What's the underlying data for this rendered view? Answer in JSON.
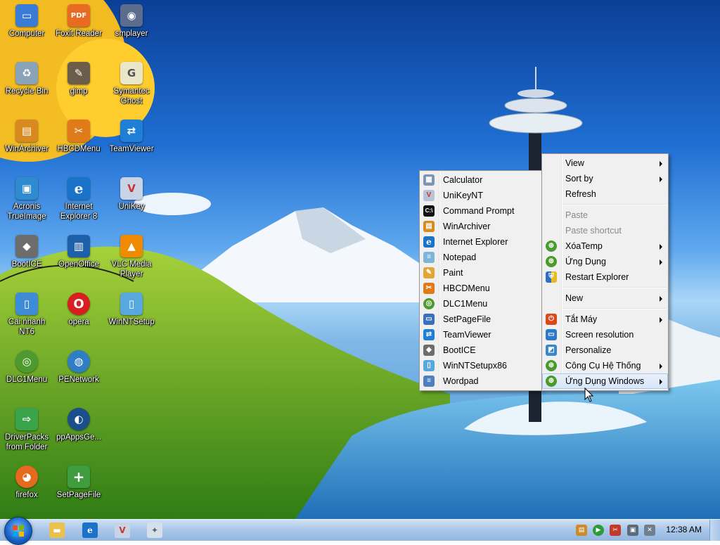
{
  "desktop_icons": [
    {
      "label": "Computer",
      "icon": "computer-icon",
      "color": "#3a7bd5",
      "glyph": "▭"
    },
    {
      "label": "Foxit Reader",
      "icon": "pdf-icon",
      "color": "#e96b22",
      "glyph": "PDF"
    },
    {
      "label": "smplayer",
      "icon": "smplayer-icon",
      "color": "#5b6c8c",
      "glyph": "◉"
    },
    {
      "label": "Recycle Bin",
      "icon": "recycle-bin-icon",
      "color": "#8ba3b9",
      "glyph": "♻"
    },
    {
      "label": "gimp",
      "icon": "gimp-icon",
      "color": "#6b5d4a",
      "glyph": "✎"
    },
    {
      "label": "Symantec Ghost",
      "icon": "ghost-icon",
      "color": "#e9e7c8",
      "glyph": "👻"
    },
    {
      "label": "WinArchiver",
      "icon": "archive-icon",
      "color": "#d98a1e",
      "glyph": "▤"
    },
    {
      "label": "HBCDMenu",
      "icon": "tools-icon",
      "color": "#e07b1a",
      "glyph": "✂"
    },
    {
      "label": "TeamViewer",
      "icon": "teamviewer-icon",
      "color": "#1f7fd6",
      "glyph": "⇄"
    },
    {
      "label": "Acronis TrueImage",
      "icon": "acronis-icon",
      "color": "#2e8bd0",
      "glyph": "▣"
    },
    {
      "label": "Internet Explorer 8",
      "icon": "ie-icon",
      "color": "#1a73c9",
      "glyph": "e"
    },
    {
      "label": "UniKey",
      "icon": "unikey-icon",
      "color": "#c8d4e6",
      "glyph": "V"
    },
    {
      "label": "BootICE",
      "icon": "bootice-icon",
      "color": "#6d6d6d",
      "glyph": "◆"
    },
    {
      "label": "OpenOffice",
      "icon": "openoffice-icon",
      "color": "#1d5fa8",
      "glyph": "▥"
    },
    {
      "label": "VLC Media Player",
      "icon": "vlc-icon",
      "color": "#f08a00",
      "glyph": "▲"
    },
    {
      "label": "Cai nhanh NT6",
      "icon": "setup-icon",
      "color": "#3e8bd6",
      "glyph": "▯"
    },
    {
      "label": "opera",
      "icon": "opera-icon",
      "color": "#d81e1e",
      "glyph": "O"
    },
    {
      "label": "WinNTSetup",
      "icon": "winntsetup-icon",
      "color": "#58a8e0",
      "glyph": "▯"
    },
    {
      "label": "DLC1Menu",
      "icon": "dlc-icon",
      "color": "#4f9a2e",
      "glyph": "◎"
    },
    {
      "label": "PENetwork",
      "icon": "network-icon",
      "color": "#2d7ec4",
      "glyph": "◍"
    },
    {
      "label": "DriverPacks from Folder",
      "icon": "driverpacks-icon",
      "color": "#3aa44a",
      "glyph": "⇨"
    },
    {
      "label": "ppAppsGe...",
      "icon": "ppapps-icon",
      "color": "#1a4f8a",
      "glyph": "◐"
    },
    {
      "label": "firefox",
      "icon": "firefox-icon",
      "color": "#e66a1e",
      "glyph": "◕"
    },
    {
      "label": "SetPageFile",
      "icon": "pagefile-icon",
      "color": "#3f9c3f",
      "glyph": "+"
    }
  ],
  "context_menu": {
    "items": [
      {
        "label": "View",
        "submenu": true
      },
      {
        "label": "Sort by",
        "submenu": true
      },
      {
        "label": "Refresh"
      },
      {
        "sep": true
      },
      {
        "label": "Paste",
        "disabled": true
      },
      {
        "label": "Paste shortcut",
        "disabled": true
      },
      {
        "label": "XóaTemp",
        "submenu": true,
        "icon": "green-orb-icon",
        "color": "#4a9a2c"
      },
      {
        "label": "Ứng Dụng",
        "submenu": true,
        "icon": "green-orb-icon",
        "color": "#4a9a2c"
      },
      {
        "label": "Restart Explorer",
        "icon": "shield-icon",
        "color": "#2f6fc0"
      },
      {
        "sep": true
      },
      {
        "label": "New",
        "submenu": true
      },
      {
        "sep": true
      },
      {
        "label": "Tắt Máy",
        "submenu": true,
        "icon": "power-icon",
        "color": "#d9491c"
      },
      {
        "label": "Screen resolution",
        "icon": "monitor-icon",
        "color": "#2f79c8"
      },
      {
        "label": "Personalize",
        "icon": "personalize-icon",
        "color": "#3a86c9"
      },
      {
        "label": "Công Cụ Hệ Thống",
        "submenu": true,
        "icon": "green-orb-icon",
        "color": "#4a9a2c"
      },
      {
        "label": "Ứng Dụng Windows",
        "submenu": true,
        "icon": "green-orb-icon",
        "color": "#4a9a2c",
        "highlighted": true
      }
    ]
  },
  "submenu": {
    "items": [
      {
        "label": "Calculator",
        "icon": "calculator-icon",
        "color": "#7b95b3"
      },
      {
        "label": "UniKeyNT",
        "icon": "unikey-icon",
        "color": "#b7c3d6"
      },
      {
        "label": "Command Prompt",
        "icon": "cmd-icon",
        "color": "#111111"
      },
      {
        "label": "WinArchiver",
        "icon": "archive-icon",
        "color": "#d98a1e"
      },
      {
        "label": "Internet Explorer",
        "icon": "ie-icon",
        "color": "#1a73c9"
      },
      {
        "label": "Notepad",
        "icon": "notepad-icon",
        "color": "#7fb4d9"
      },
      {
        "label": "Paint",
        "icon": "paint-icon",
        "color": "#e0a63a"
      },
      {
        "label": "HBCDMenu",
        "icon": "tools-icon",
        "color": "#e07b1a"
      },
      {
        "label": "DLC1Menu",
        "icon": "dlc-icon",
        "color": "#4f9a2e"
      },
      {
        "label": "SetPageFile",
        "icon": "pagefile-icon",
        "color": "#3a6fbe"
      },
      {
        "label": "TeamViewer",
        "icon": "teamviewer-icon",
        "color": "#1f7fd6"
      },
      {
        "label": "BootICE",
        "icon": "bootice-icon",
        "color": "#6d6d6d"
      },
      {
        "label": "WinNTSetupx86",
        "icon": "winntsetup-icon",
        "color": "#58a8e0"
      },
      {
        "label": "Wordpad",
        "icon": "wordpad-icon",
        "color": "#4f7fbf"
      }
    ]
  },
  "taskbar": {
    "pinned": [
      {
        "name": "explorer",
        "icon": "folder-icon",
        "color": "#e9c14c"
      },
      {
        "name": "internet-explorer",
        "icon": "ie-icon",
        "color": "#1a73c9"
      },
      {
        "name": "unikey",
        "icon": "unikey-icon",
        "color": "#c8d4e6"
      },
      {
        "name": "notes",
        "icon": "ghost-icon",
        "color": "#d6e0ea"
      }
    ],
    "tray": [
      {
        "name": "tray-archive",
        "icon": "archive-icon",
        "color": "#c98b2b"
      },
      {
        "name": "tray-play",
        "icon": "play-icon",
        "color": "#2e9a3a"
      },
      {
        "name": "tray-tools",
        "icon": "tools-icon",
        "color": "#c23a2a"
      },
      {
        "name": "tray-network",
        "icon": "network-icon",
        "color": "#5a6b7c"
      },
      {
        "name": "tray-volume",
        "icon": "volume-muted-icon",
        "color": "#6f7f90"
      }
    ],
    "clock": "12:38 AM"
  }
}
